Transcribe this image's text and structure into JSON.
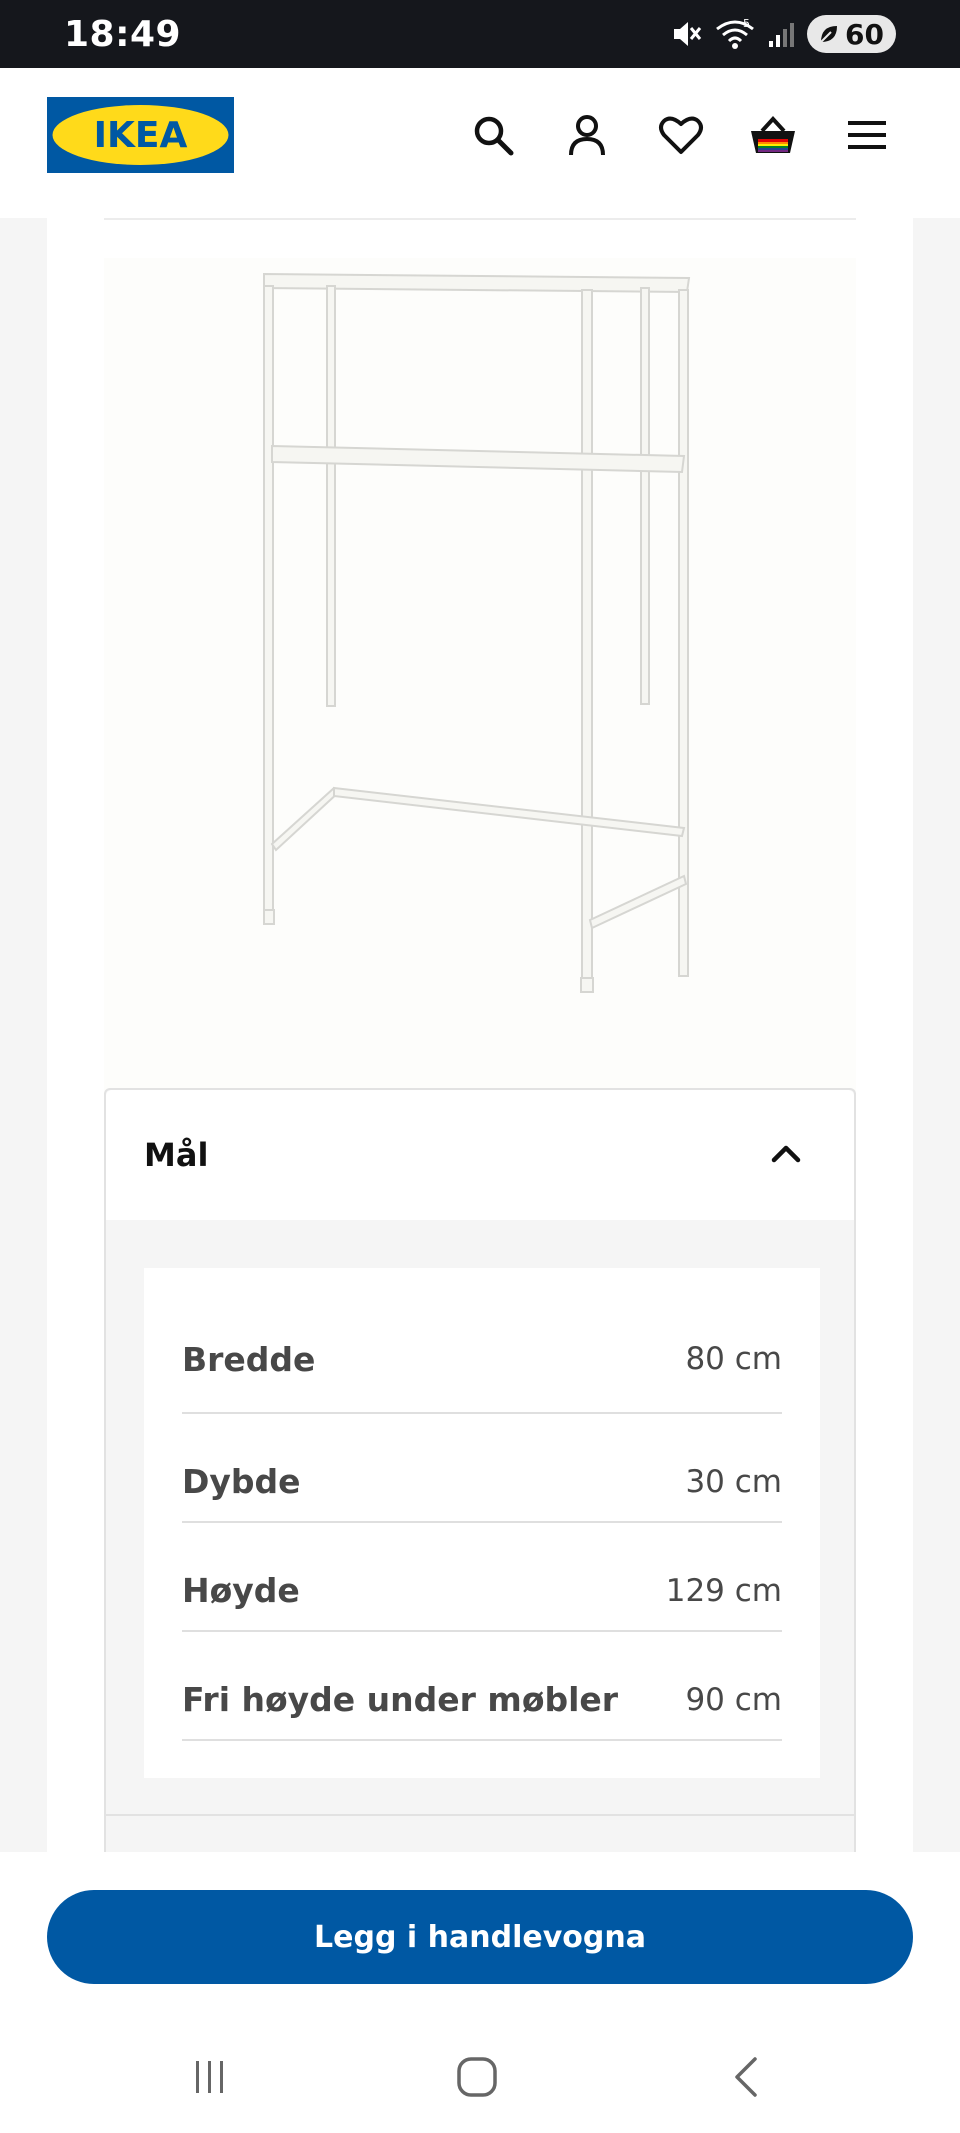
{
  "status": {
    "time": "18:49",
    "battery": "60",
    "wifi_label": "5"
  },
  "header": {
    "logo_text": "IKEA",
    "icons": [
      "search-icon",
      "account-icon",
      "heart-icon",
      "cart-icon",
      "menu-icon"
    ]
  },
  "accordion": {
    "title": "Mål",
    "expanded": true,
    "rows": [
      {
        "label": "Bredde",
        "value": "80 cm"
      },
      {
        "label": "Dybde",
        "value": "30 cm"
      },
      {
        "label": "Høyde",
        "value": "129 cm"
      },
      {
        "label": "Fri høyde under møbler",
        "value": "90 cm"
      }
    ]
  },
  "cta": {
    "label": "Legg i handlevogna"
  },
  "colors": {
    "brand_blue": "#0058a3",
    "logo_yellow": "#ffda1a",
    "logo_blue": "#0058a3"
  },
  "nav": [
    "recents-icon",
    "home-icon",
    "back-icon"
  ]
}
